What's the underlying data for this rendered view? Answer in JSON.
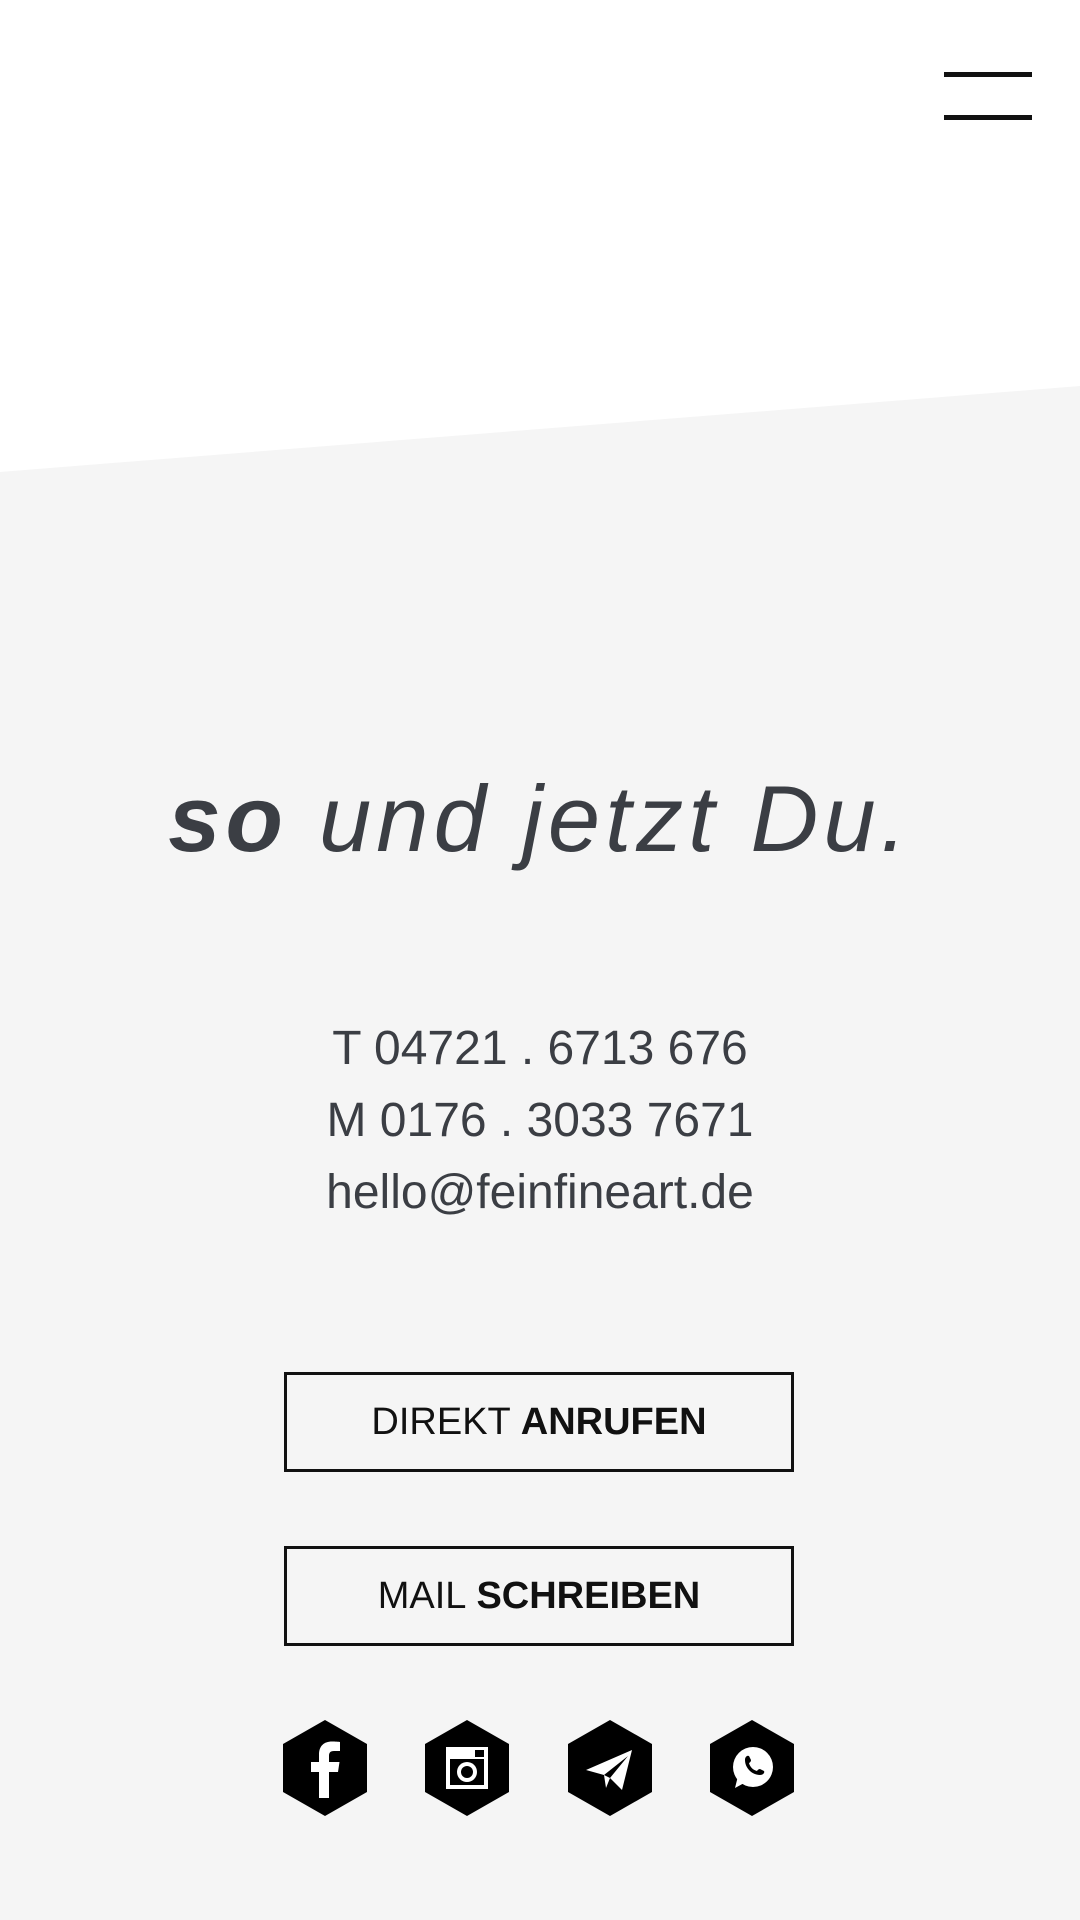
{
  "colors": {
    "background_top": "#ffffff",
    "background_lower": "#f5f5f5",
    "text": "#3b3e44",
    "accent": "#111111"
  },
  "header": {
    "menu_icon": "hamburger-menu-icon"
  },
  "headline": {
    "strong": "so",
    "rest": "und jetzt Du."
  },
  "contact": {
    "phone": "T 04721 . 6713 676",
    "mobile": "M 0176 . 3033 7671",
    "email": "hello@feinfineart.de"
  },
  "buttons": {
    "call": {
      "prefix": "DIREKT",
      "emphasis": "ANRUFEN"
    },
    "mail": {
      "prefix": "MAIL",
      "emphasis": "SCHREIBEN"
    }
  },
  "social": [
    {
      "icon": "facebook-icon"
    },
    {
      "icon": "instagram-icon"
    },
    {
      "icon": "telegram-icon"
    },
    {
      "icon": "whatsapp-icon"
    }
  ]
}
